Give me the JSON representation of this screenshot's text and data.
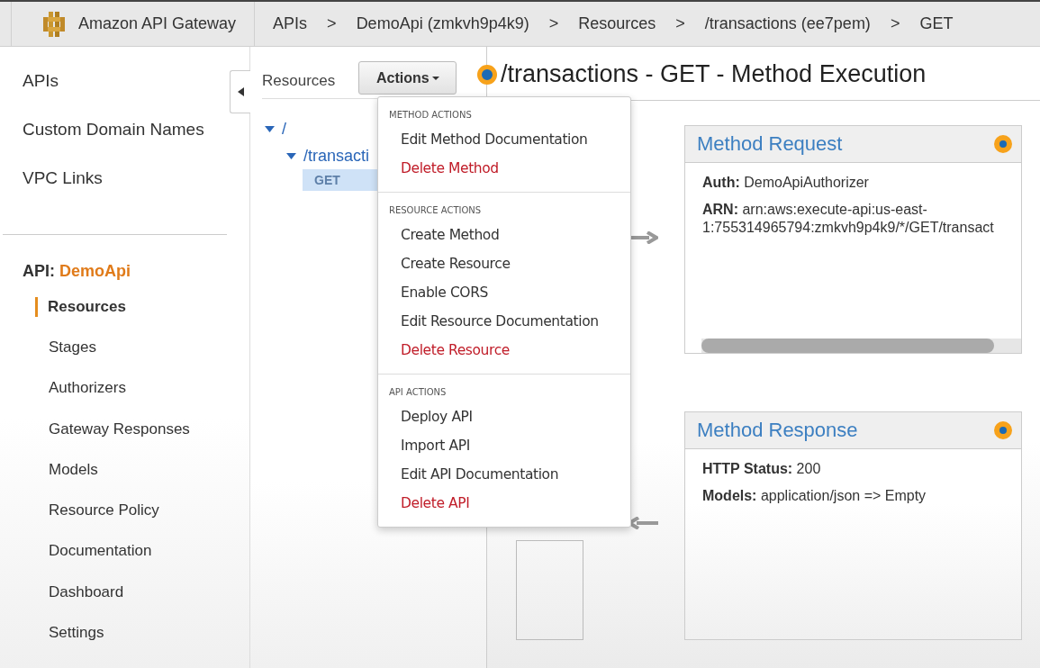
{
  "topbar": {
    "brand": "Amazon API Gateway",
    "breadcrumbs": [
      {
        "label": "APIs",
        "separator": ">"
      },
      {
        "label": "DemoApi (zmkvh9p4k9)",
        "separator": ">"
      },
      {
        "label": "Resources",
        "separator": ">"
      },
      {
        "label": "/transactions (ee7pem)",
        "separator": ">"
      },
      {
        "label": "GET"
      }
    ]
  },
  "sidebar": {
    "top_links": [
      {
        "label": "APIs",
        "selected": false
      },
      {
        "label": "Custom Domain Names",
        "selected": false
      },
      {
        "label": "VPC Links",
        "selected": false
      }
    ],
    "api_heading": {
      "prefix": "API:",
      "name": "DemoApi"
    },
    "items": [
      {
        "label": "Resources",
        "selected": true
      },
      {
        "label": "Stages",
        "selected": false
      },
      {
        "label": "Authorizers",
        "selected": false
      },
      {
        "label": "Gateway Responses",
        "selected": false
      },
      {
        "label": "Models",
        "selected": false
      },
      {
        "label": "Resource Policy",
        "selected": false
      },
      {
        "label": "Documentation",
        "selected": false
      },
      {
        "label": "Dashboard",
        "selected": false
      },
      {
        "label": "Settings",
        "selected": false
      }
    ]
  },
  "resources": {
    "title": "Resources",
    "actions_button": "Actions",
    "tree": [
      {
        "label": "/",
        "expanded": true,
        "children": [
          {
            "label": "/transacti",
            "expanded": true,
            "children": [
              {
                "label": "GET",
                "selected": true
              }
            ]
          }
        ]
      }
    ]
  },
  "actions_menu": {
    "sections": [
      {
        "heading": "METHOD ACTIONS",
        "items": [
          {
            "label": "Edit Method Documentation",
            "destructive": false
          },
          {
            "label": "Delete Method",
            "destructive": true
          }
        ]
      },
      {
        "heading": "RESOURCE ACTIONS",
        "items": [
          {
            "label": "Create Method",
            "destructive": false
          },
          {
            "label": "Create Resource",
            "destructive": false
          },
          {
            "label": "Enable CORS",
            "destructive": false
          },
          {
            "label": "Edit Resource Documentation",
            "destructive": false
          },
          {
            "label": "Delete Resource",
            "destructive": true
          }
        ]
      },
      {
        "heading": "API ACTIONS",
        "items": [
          {
            "label": "Deploy API",
            "destructive": false
          },
          {
            "label": "Import API",
            "destructive": false
          },
          {
            "label": "Edit API Documentation",
            "destructive": false
          },
          {
            "label": "Delete API",
            "destructive": true
          }
        ]
      }
    ]
  },
  "page_title": "/transactions - GET - Method Execution",
  "method_request": {
    "title": "Method Request",
    "fields": [
      {
        "label": "Auth:",
        "value": "DemoApiAuthorizer"
      },
      {
        "label": "ARN:",
        "value": "arn:aws:execute-api:us-east-1:755314965794:zmkvh9p4k9/*/GET/transact"
      }
    ]
  },
  "method_response": {
    "title": "Method Response",
    "fields": [
      {
        "label": "HTTP Status:",
        "value": "200"
      },
      {
        "label": "Models:",
        "value": "application/json => Empty"
      }
    ]
  }
}
